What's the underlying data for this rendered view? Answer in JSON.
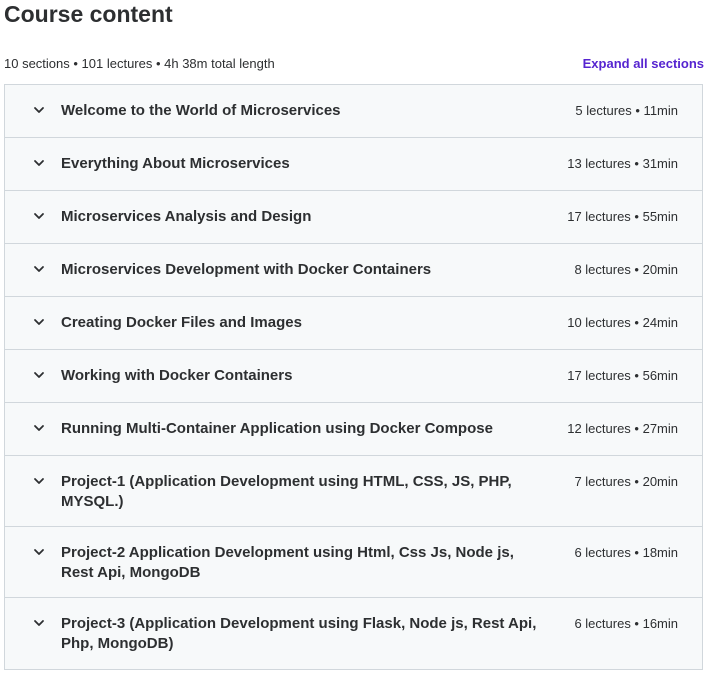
{
  "header": {
    "title": "Course content",
    "summary": "10 sections • 101 lectures • 4h 38m total length",
    "expand_label": "Expand all sections"
  },
  "sections": [
    {
      "title": "Welcome to the World of Microservices",
      "meta": "5 lectures • 11min"
    },
    {
      "title": "Everything About Microservices",
      "meta": "13 lectures • 31min"
    },
    {
      "title": "Microservices Analysis and Design",
      "meta": "17 lectures • 55min"
    },
    {
      "title": "Microservices Development with Docker Containers",
      "meta": "8 lectures • 20min"
    },
    {
      "title": "Creating Docker Files and Images",
      "meta": "10 lectures • 24min"
    },
    {
      "title": "Working with Docker Containers",
      "meta": "17 lectures • 56min"
    },
    {
      "title": "Running Multi-Container Application using Docker Compose",
      "meta": "12 lectures • 27min"
    },
    {
      "title": "Project-1 (Application Development using HTML, CSS, JS, PHP, MYSQL.)",
      "meta": "7 lectures • 20min"
    },
    {
      "title": "Project-2 Application Development using Html, Css Js, Node js, Rest Api, MongoDB",
      "meta": "6 lectures • 18min"
    },
    {
      "title": "Project-3 (Application Development using Flask, Node js, Rest Api, Php, MongoDB)",
      "meta": "6 lectures • 16min"
    }
  ],
  "icons": {
    "chevron": "chevron-down-icon"
  },
  "colors": {
    "text": "#2d2f31",
    "link": "#5624d0",
    "section_bg": "#f7f9fa",
    "border": "#d1d7dc"
  }
}
